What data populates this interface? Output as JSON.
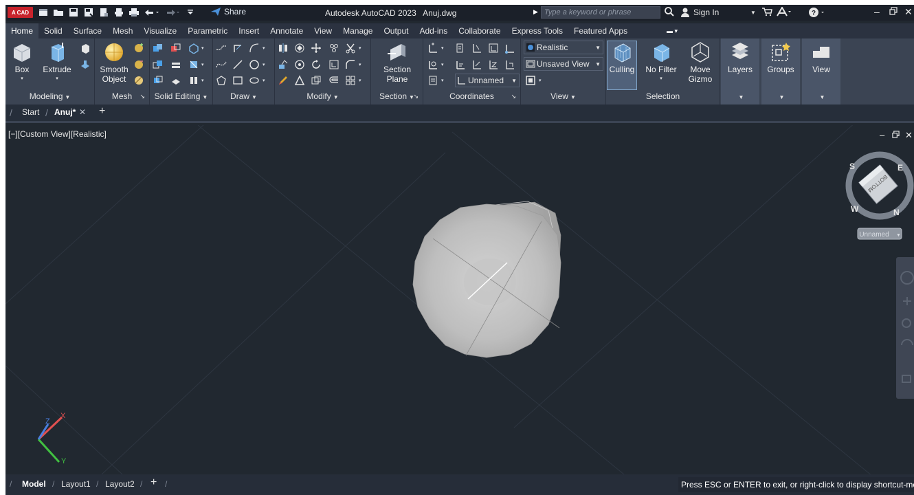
{
  "titlebar": {
    "logo_text": "A CAD",
    "quick_access_icons": [
      "new-icon",
      "open-icon",
      "save-icon",
      "save-as-icon",
      "share-file-icon",
      "plot-icon",
      "print-icon",
      "undo-icon",
      "redo-icon",
      "customize-icon"
    ],
    "share_label": "Share",
    "app_title": "Autodesk AutoCAD 2023",
    "file_name": "Anuj.dwg",
    "search_placeholder": "Type a keyword or phrase",
    "sign_in_label": "Sign In"
  },
  "ribbon_tabs": [
    "Home",
    "Solid",
    "Surface",
    "Mesh",
    "Visualize",
    "Parametric",
    "Insert",
    "Annotate",
    "View",
    "Manage",
    "Output",
    "Add-ins",
    "Collaborate",
    "Express Tools",
    "Featured Apps"
  ],
  "ribbon": {
    "modeling": {
      "title": "Modeling",
      "box": "Box",
      "extrude": "Extrude"
    },
    "mesh": {
      "title": "Mesh",
      "smooth_line1": "Smooth",
      "smooth_line2": "Object"
    },
    "solid_editing": {
      "title": "Solid Editing"
    },
    "draw": {
      "title": "Draw"
    },
    "modify": {
      "title": "Modify"
    },
    "section": {
      "title": "Section",
      "plane_line1": "Section",
      "plane_line2": "Plane"
    },
    "coordinates": {
      "title": "Coordinates",
      "ucs_name": "Unnamed"
    },
    "view": {
      "title": "View",
      "visual_style": "Realistic",
      "named_view": "Unsaved View"
    },
    "selection": {
      "title": "Selection",
      "culling": "Culling",
      "no_filter": "No Filter",
      "move_line1": "Move",
      "move_line2": "Gizmo"
    },
    "layers": "Layers",
    "groups": "Groups",
    "view_panel": "View"
  },
  "file_tabs": {
    "start": "Start",
    "active": "Anuj*"
  },
  "viewport": {
    "label": "[−][Custom View][Realistic]",
    "viewcube_face": "BOTTOM",
    "compass": {
      "s": "S",
      "e": "E",
      "w": "W",
      "n": "N"
    },
    "ucs_menu": "Unnamed",
    "axes": {
      "x": "X",
      "y": "Y",
      "z": "Z"
    }
  },
  "status": {
    "layout_tabs": [
      "Model",
      "Layout1",
      "Layout2"
    ],
    "command_message": "Press ESC or ENTER to exit, or right-click to display shortcut-menu"
  },
  "colors": {
    "background": "#212830",
    "ribbon": "#3b4453",
    "logo_red": "#c8232c",
    "accent_blue": "#4a90d9"
  }
}
